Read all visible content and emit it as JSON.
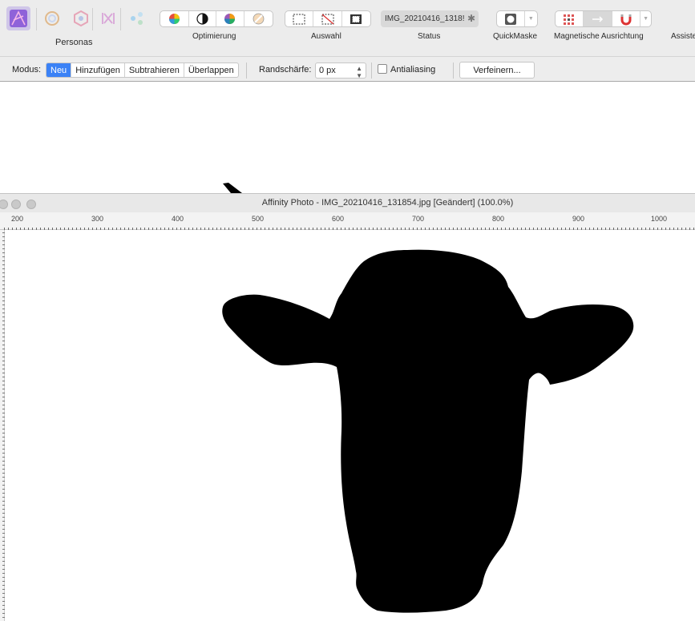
{
  "toolbar": {
    "groups": {
      "personas": "Personas",
      "optimierung": "Optimierung",
      "auswahl": "Auswahl",
      "status": "Status",
      "quickmaske": "QuickMaske",
      "magnetisch": "Magnetische Ausrichtung",
      "assistent": "Assiste"
    },
    "status_value": "IMG_20210416_1318!",
    "status_modified": "✱"
  },
  "context_bar": {
    "modus_label": "Modus:",
    "modes": [
      "Neu",
      "Hinzufügen",
      "Subtrahieren",
      "Überlappen"
    ],
    "active_mode": "Neu",
    "feather_label": "Randschärfe:",
    "feather_value": "0 px",
    "antialias_label": "Antialiasing",
    "antialias_checked": false,
    "refine_label": "Verfeinern..."
  },
  "document": {
    "title": "Affinity Photo - IMG_20210416_131854.jpg [Geändert] (100.0%)",
    "ruler_labels": [
      "200",
      "300",
      "400",
      "500",
      "600",
      "700",
      "800",
      "900",
      "1000"
    ]
  },
  "colors": {
    "accent": "#3b82f6",
    "persona_active": "#cfc6e8",
    "silhouette": "#000000"
  }
}
